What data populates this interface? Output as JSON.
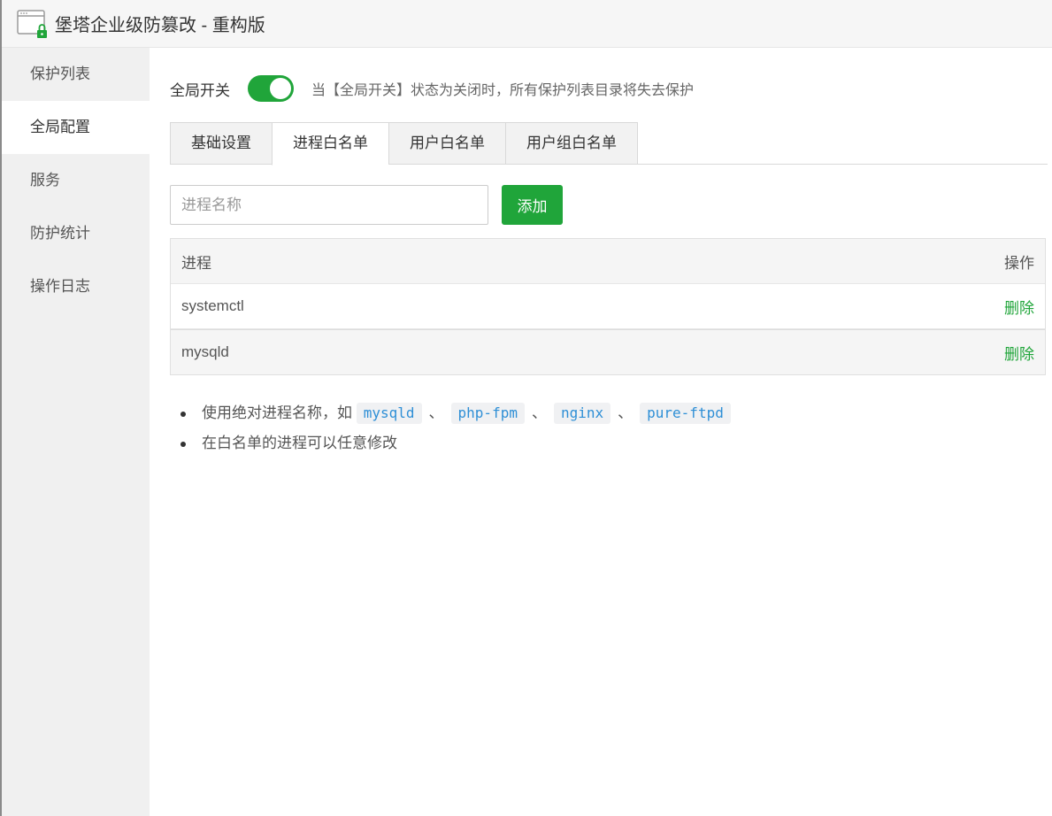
{
  "app": {
    "title": "堡塔企业级防篡改 - 重构版",
    "accent": "#20a53a"
  },
  "sidebar": {
    "items": [
      {
        "label": "保护列表"
      },
      {
        "label": "全局配置"
      },
      {
        "label": "服务"
      },
      {
        "label": "防护统计"
      },
      {
        "label": "操作日志"
      }
    ],
    "active": "全局配置"
  },
  "global_switch": {
    "label": "全局开关",
    "state": "on",
    "description": "当【全局开关】状态为关闭时，所有保护列表目录将失去保护"
  },
  "tabs": [
    {
      "label": "基础设置"
    },
    {
      "label": "进程白名单"
    },
    {
      "label": "用户白名单"
    },
    {
      "label": "用户组白名单"
    }
  ],
  "active_tab": "进程白名单",
  "add_form": {
    "placeholder": "进程名称",
    "value": "",
    "button_label": "添加"
  },
  "table": {
    "headers": {
      "process": "进程",
      "action": "操作"
    },
    "rows": [
      {
        "process": "systemctl",
        "action": "删除"
      },
      {
        "process": "mysqld",
        "action": "删除"
      }
    ]
  },
  "notes": {
    "line1_prefix": "使用绝对进程名称，如",
    "examples": [
      "mysqld",
      "php-fpm",
      "nginx",
      "pure-ftpd"
    ],
    "separator": "、",
    "line2": "在白名单的进程可以任意修改"
  }
}
